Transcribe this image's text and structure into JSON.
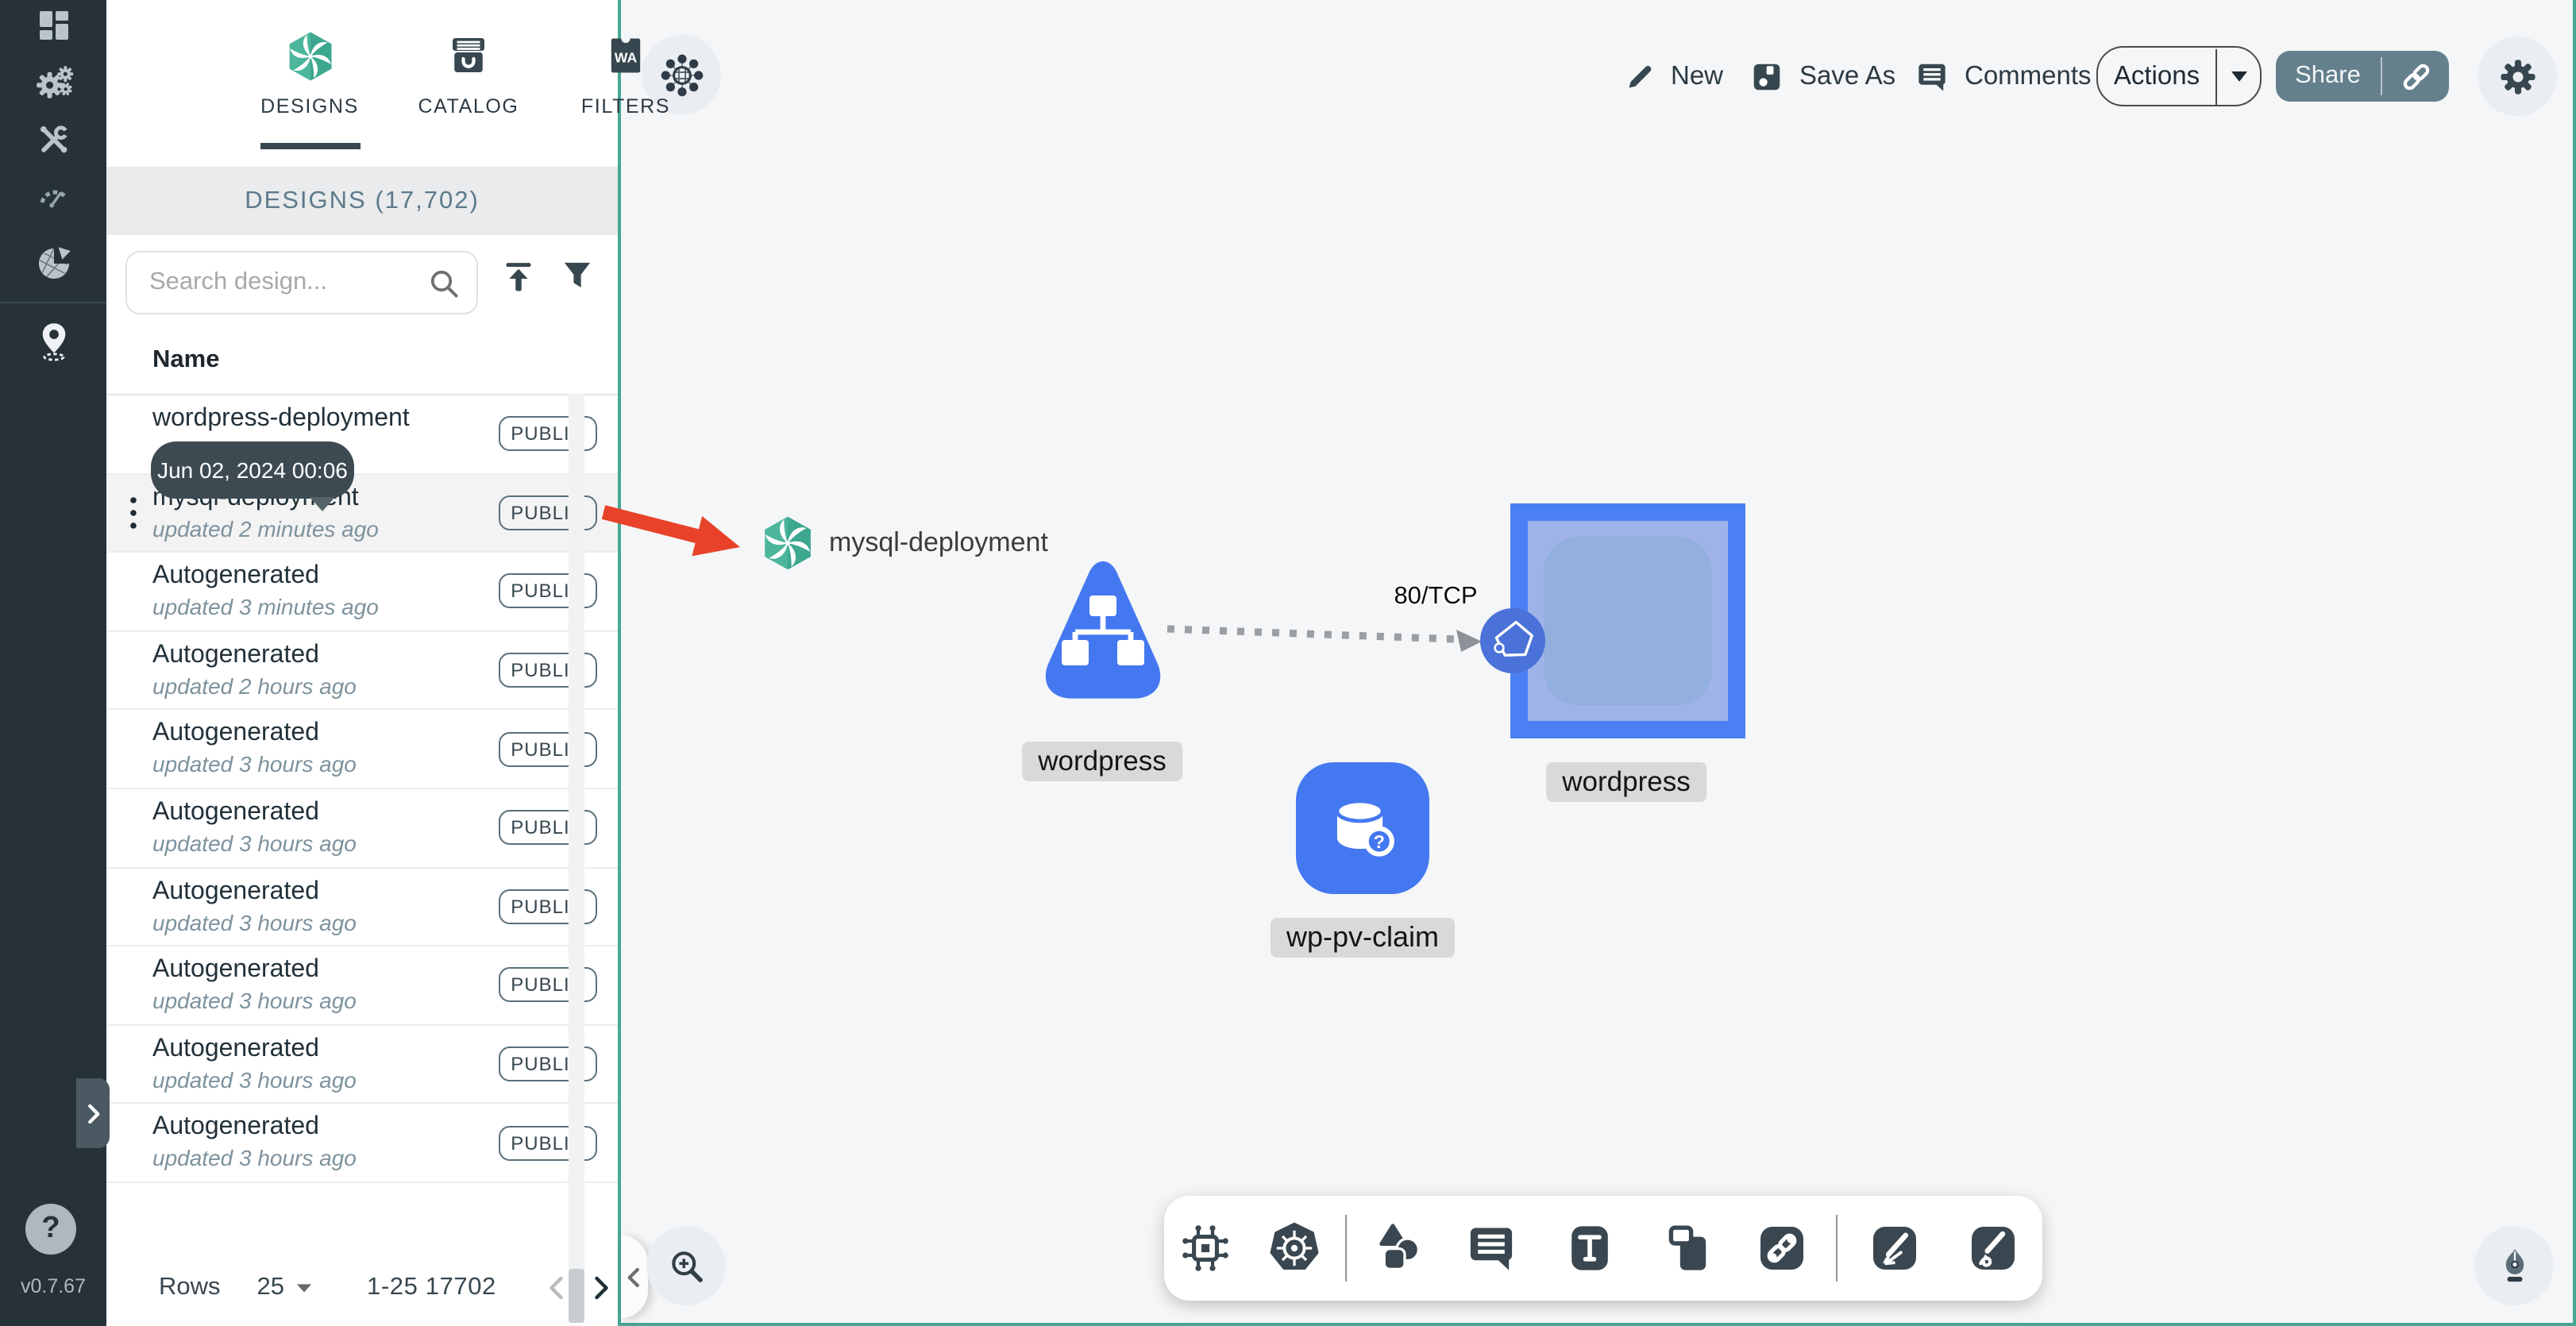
{
  "app": {
    "version": "v0.7.67"
  },
  "sidebar": {
    "icons": [
      "dashboard",
      "lifecycle-gears",
      "configuration-tools",
      "performance-gauge",
      "extensions",
      "kanvas-pin"
    ],
    "help_label": "?"
  },
  "panel": {
    "tabs": [
      {
        "label": "DESIGNS",
        "active": true
      },
      {
        "label": "CATALOG",
        "active": false
      },
      {
        "label": "FILTERS",
        "active": false
      }
    ],
    "header": "DESIGNS (17,702)",
    "search": {
      "placeholder": "Search design..."
    },
    "table": {
      "name_header": "Name"
    },
    "tooltip": "Jun 02, 2024 00:06",
    "rows": [
      {
        "name": "wordpress-deployment",
        "updated": "",
        "badge": "PUBLIC"
      },
      {
        "name": "mysql-deployment",
        "updated": "updated 2 minutes ago",
        "badge": "PUBLIC"
      },
      {
        "name": "Autogenerated",
        "updated": "updated 3 minutes ago",
        "badge": "PUBLIC"
      },
      {
        "name": "Autogenerated",
        "updated": "updated 2 hours ago",
        "badge": "PUBLIC"
      },
      {
        "name": "Autogenerated",
        "updated": "updated 3 hours ago",
        "badge": "PUBLIC"
      },
      {
        "name": "Autogenerated",
        "updated": "updated 3 hours ago",
        "badge": "PUBLIC"
      },
      {
        "name": "Autogenerated",
        "updated": "updated 3 hours ago",
        "badge": "PUBLIC"
      },
      {
        "name": "Autogenerated",
        "updated": "updated 3 hours ago",
        "badge": "PUBLIC"
      },
      {
        "name": "Autogenerated",
        "updated": "updated 3 hours ago",
        "badge": "PUBLIC"
      },
      {
        "name": "Autogenerated",
        "updated": "updated 3 hours ago",
        "badge": "PUBLIC"
      }
    ],
    "pagination": {
      "rows_label": "Rows",
      "per_page": "25",
      "range": "1-25 17702"
    }
  },
  "topbar": {
    "new": "New",
    "save_as": "Save As",
    "comments": "Comments",
    "actions": "Actions",
    "share": "Share"
  },
  "canvas": {
    "floating_node_label": "mysql-deployment",
    "edge_label": "80/TCP",
    "deployment_label": "wordpress",
    "service_label": "wordpress",
    "pvc_label": "wp-pv-claim"
  },
  "colors": {
    "teal_border": "#47a795",
    "node_blue": "#4478f0",
    "selection_blue": "#4b80f4",
    "arrow_red": "#e8432a",
    "share_bg": "#64808c",
    "sidebar_bg": "#263238"
  }
}
